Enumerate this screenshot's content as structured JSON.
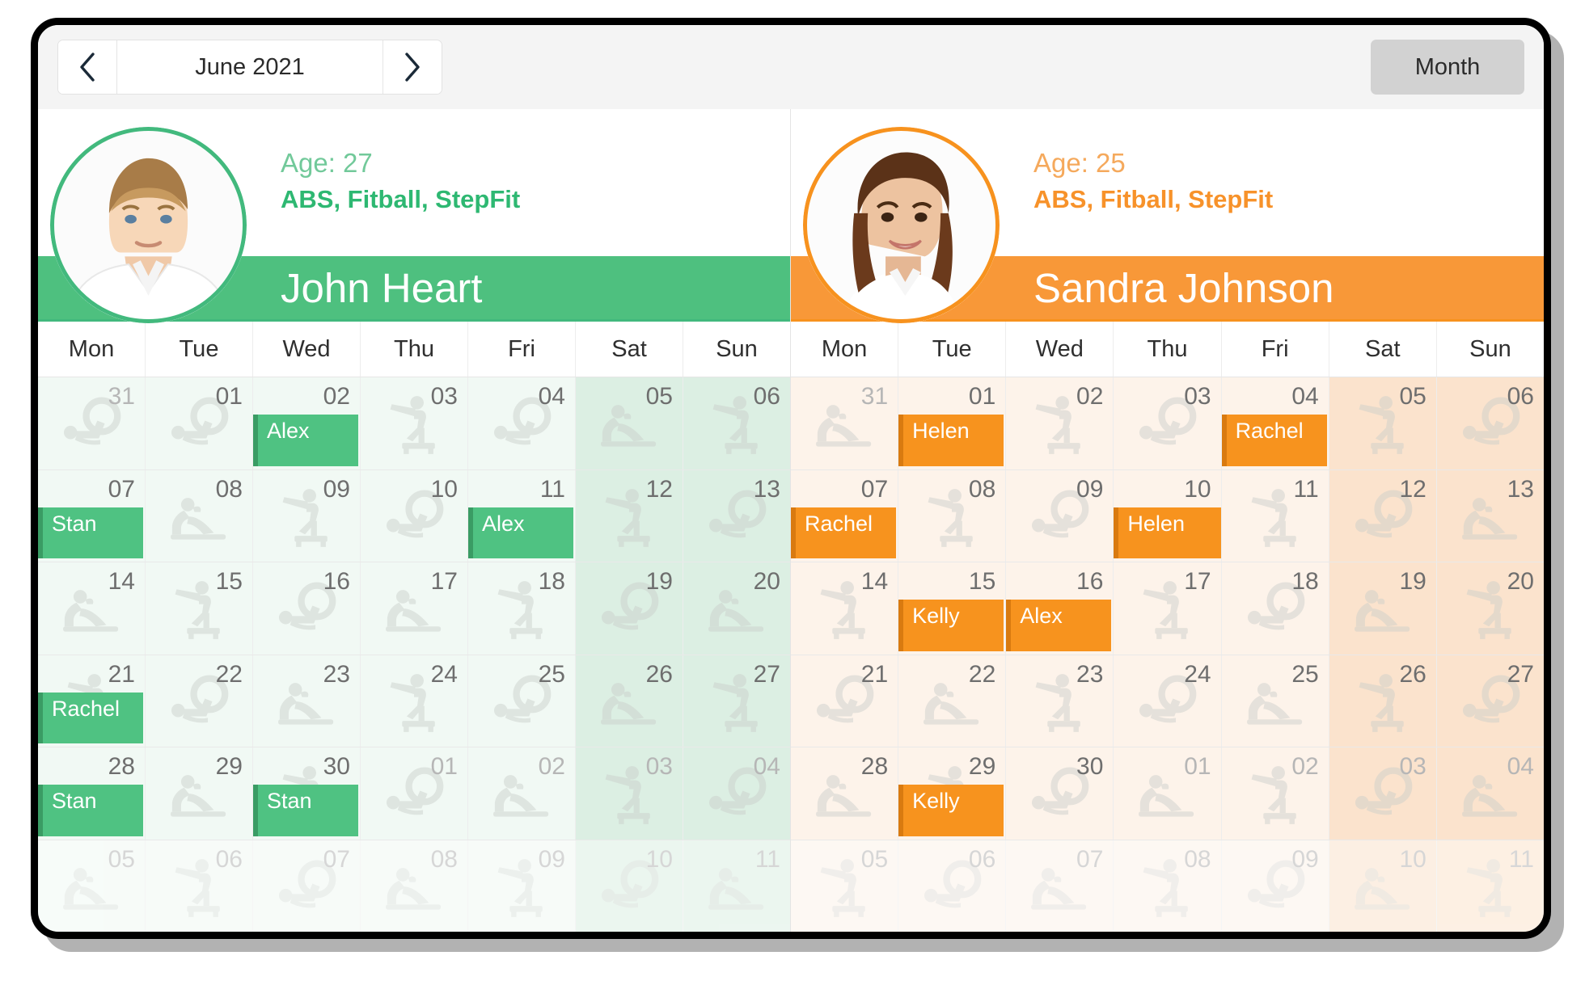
{
  "toolbar": {
    "prev_label": "chevron-left",
    "next_label": "chevron-right",
    "current_period": "June 2021",
    "view_label": "Month"
  },
  "weekdays": [
    "Mon",
    "Tue",
    "Wed",
    "Thu",
    "Fri",
    "Sat",
    "Sun"
  ],
  "panes": [
    {
      "id": "john",
      "theme": "green",
      "accent": "#4ec07f",
      "name": "John Heart",
      "age_label": "Age: 27",
      "classes": "ABS, Fitball, StepFit",
      "avatar": "male-portrait",
      "weeks": [
        {
          "days": [
            {
              "num": "31",
              "other": true,
              "weekend": false,
              "icon": "fitball"
            },
            {
              "num": "01",
              "other": false,
              "weekend": false,
              "icon": "fitball"
            },
            {
              "num": "02",
              "other": false,
              "weekend": false,
              "icon": "none",
              "appt": {
                "label": "Alex",
                "span": 1
              }
            },
            {
              "num": "03",
              "other": false,
              "weekend": false,
              "icon": "stepfit"
            },
            {
              "num": "04",
              "other": false,
              "weekend": false,
              "icon": "fitball"
            },
            {
              "num": "05",
              "other": false,
              "weekend": true,
              "icon": "abs"
            },
            {
              "num": "06",
              "other": false,
              "weekend": true,
              "icon": "stepfit"
            }
          ]
        },
        {
          "days": [
            {
              "num": "07",
              "other": false,
              "weekend": false,
              "icon": "none",
              "appt": {
                "label": "Stan",
                "span": 1
              }
            },
            {
              "num": "08",
              "other": false,
              "weekend": false,
              "icon": "abs"
            },
            {
              "num": "09",
              "other": false,
              "weekend": false,
              "icon": "stepfit"
            },
            {
              "num": "10",
              "other": false,
              "weekend": false,
              "icon": "fitball"
            },
            {
              "num": "11",
              "other": false,
              "weekend": false,
              "icon": "none",
              "appt": {
                "label": "Alex",
                "span": 1
              }
            },
            {
              "num": "12",
              "other": false,
              "weekend": true,
              "icon": "stepfit"
            },
            {
              "num": "13",
              "other": false,
              "weekend": true,
              "icon": "fitball"
            }
          ]
        },
        {
          "days": [
            {
              "num": "14",
              "other": false,
              "weekend": false,
              "icon": "abs"
            },
            {
              "num": "15",
              "other": false,
              "weekend": false,
              "icon": "stepfit"
            },
            {
              "num": "16",
              "other": false,
              "weekend": false,
              "icon": "fitball"
            },
            {
              "num": "17",
              "other": false,
              "weekend": false,
              "icon": "abs"
            },
            {
              "num": "18",
              "other": false,
              "weekend": false,
              "icon": "stepfit"
            },
            {
              "num": "19",
              "other": false,
              "weekend": true,
              "icon": "fitball"
            },
            {
              "num": "20",
              "other": false,
              "weekend": true,
              "icon": "abs"
            }
          ]
        },
        {
          "days": [
            {
              "num": "21",
              "other": false,
              "weekend": false,
              "icon": "stepfit",
              "appt": {
                "label": "Rachel",
                "span": 1
              }
            },
            {
              "num": "22",
              "other": false,
              "weekend": false,
              "icon": "fitball"
            },
            {
              "num": "23",
              "other": false,
              "weekend": false,
              "icon": "abs"
            },
            {
              "num": "24",
              "other": false,
              "weekend": false,
              "icon": "stepfit"
            },
            {
              "num": "25",
              "other": false,
              "weekend": false,
              "icon": "fitball"
            },
            {
              "num": "26",
              "other": false,
              "weekend": true,
              "icon": "abs"
            },
            {
              "num": "27",
              "other": false,
              "weekend": true,
              "icon": "stepfit"
            }
          ]
        },
        {
          "days": [
            {
              "num": "28",
              "other": false,
              "weekend": false,
              "icon": "none",
              "appt": {
                "label": "Stan",
                "span": 1
              }
            },
            {
              "num": "29",
              "other": false,
              "weekend": false,
              "icon": "abs"
            },
            {
              "num": "30",
              "other": false,
              "weekend": false,
              "icon": "stepfit",
              "appt": {
                "label": "Stan",
                "span": 1
              }
            },
            {
              "num": "01",
              "other": true,
              "weekend": false,
              "icon": "fitball"
            },
            {
              "num": "02",
              "other": true,
              "weekend": false,
              "icon": "abs"
            },
            {
              "num": "03",
              "other": true,
              "weekend": true,
              "icon": "stepfit"
            },
            {
              "num": "04",
              "other": true,
              "weekend": true,
              "icon": "fitball"
            }
          ]
        },
        {
          "faded": true,
          "days": [
            {
              "num": "05",
              "other": true,
              "weekend": false,
              "icon": "abs"
            },
            {
              "num": "06",
              "other": true,
              "weekend": false,
              "icon": "stepfit"
            },
            {
              "num": "07",
              "other": true,
              "weekend": false,
              "icon": "fitball"
            },
            {
              "num": "08",
              "other": true,
              "weekend": false,
              "icon": "abs"
            },
            {
              "num": "09",
              "other": true,
              "weekend": false,
              "icon": "stepfit"
            },
            {
              "num": "10",
              "other": true,
              "weekend": true,
              "icon": "fitball"
            },
            {
              "num": "11",
              "other": true,
              "weekend": true,
              "icon": "abs"
            }
          ]
        }
      ]
    },
    {
      "id": "sandra",
      "theme": "orange",
      "accent": "#f7931e",
      "name": "Sandra Johnson",
      "age_label": "Age: 25",
      "classes": "ABS, Fitball, StepFit",
      "avatar": "female-portrait",
      "weeks": [
        {
          "days": [
            {
              "num": "31",
              "other": true,
              "weekend": false,
              "icon": "abs"
            },
            {
              "num": "01",
              "other": false,
              "weekend": false,
              "icon": "none",
              "appt": {
                "label": "Helen",
                "span": 1
              }
            },
            {
              "num": "02",
              "other": false,
              "weekend": false,
              "icon": "stepfit"
            },
            {
              "num": "03",
              "other": false,
              "weekend": false,
              "icon": "fitball"
            },
            {
              "num": "04",
              "other": false,
              "weekend": false,
              "icon": "none",
              "appt": {
                "label": "Rachel",
                "span": 1
              }
            },
            {
              "num": "05",
              "other": false,
              "weekend": true,
              "icon": "stepfit"
            },
            {
              "num": "06",
              "other": false,
              "weekend": true,
              "icon": "fitball"
            }
          ]
        },
        {
          "days": [
            {
              "num": "07",
              "other": false,
              "weekend": false,
              "icon": "none",
              "appt": {
                "label": "Rachel",
                "span": 1
              }
            },
            {
              "num": "08",
              "other": false,
              "weekend": false,
              "icon": "stepfit"
            },
            {
              "num": "09",
              "other": false,
              "weekend": false,
              "icon": "fitball"
            },
            {
              "num": "10",
              "other": false,
              "weekend": false,
              "icon": "none",
              "appt": {
                "label": "Helen",
                "span": 2
              }
            },
            {
              "num": "11",
              "other": false,
              "weekend": false,
              "icon": "stepfit"
            },
            {
              "num": "12",
              "other": false,
              "weekend": true,
              "icon": "fitball"
            },
            {
              "num": "13",
              "other": false,
              "weekend": true,
              "icon": "abs"
            }
          ]
        },
        {
          "days": [
            {
              "num": "14",
              "other": false,
              "weekend": false,
              "icon": "stepfit"
            },
            {
              "num": "15",
              "other": false,
              "weekend": false,
              "icon": "none",
              "appt": {
                "label": "Kelly",
                "span": 1
              }
            },
            {
              "num": "16",
              "other": false,
              "weekend": false,
              "icon": "none",
              "appt": {
                "label": "Alex",
                "span": 1
              }
            },
            {
              "num": "17",
              "other": false,
              "weekend": false,
              "icon": "stepfit"
            },
            {
              "num": "18",
              "other": false,
              "weekend": false,
              "icon": "fitball"
            },
            {
              "num": "19",
              "other": false,
              "weekend": true,
              "icon": "abs"
            },
            {
              "num": "20",
              "other": false,
              "weekend": true,
              "icon": "stepfit"
            }
          ]
        },
        {
          "days": [
            {
              "num": "21",
              "other": false,
              "weekend": false,
              "icon": "fitball"
            },
            {
              "num": "22",
              "other": false,
              "weekend": false,
              "icon": "abs"
            },
            {
              "num": "23",
              "other": false,
              "weekend": false,
              "icon": "stepfit"
            },
            {
              "num": "24",
              "other": false,
              "weekend": false,
              "icon": "fitball"
            },
            {
              "num": "25",
              "other": false,
              "weekend": false,
              "icon": "abs"
            },
            {
              "num": "26",
              "other": false,
              "weekend": true,
              "icon": "stepfit"
            },
            {
              "num": "27",
              "other": false,
              "weekend": true,
              "icon": "fitball"
            }
          ]
        },
        {
          "days": [
            {
              "num": "28",
              "other": false,
              "weekend": false,
              "icon": "abs"
            },
            {
              "num": "29",
              "other": false,
              "weekend": false,
              "icon": "stepfit",
              "appt": {
                "label": "Kelly",
                "span": 1
              }
            },
            {
              "num": "30",
              "other": false,
              "weekend": false,
              "icon": "fitball"
            },
            {
              "num": "01",
              "other": true,
              "weekend": false,
              "icon": "abs"
            },
            {
              "num": "02",
              "other": true,
              "weekend": false,
              "icon": "stepfit"
            },
            {
              "num": "03",
              "other": true,
              "weekend": true,
              "icon": "fitball"
            },
            {
              "num": "04",
              "other": true,
              "weekend": true,
              "icon": "abs"
            }
          ]
        },
        {
          "faded": true,
          "days": [
            {
              "num": "05",
              "other": true,
              "weekend": false,
              "icon": "stepfit"
            },
            {
              "num": "06",
              "other": true,
              "weekend": false,
              "icon": "fitball"
            },
            {
              "num": "07",
              "other": true,
              "weekend": false,
              "icon": "abs"
            },
            {
              "num": "08",
              "other": true,
              "weekend": false,
              "icon": "stepfit"
            },
            {
              "num": "09",
              "other": true,
              "weekend": false,
              "icon": "fitball"
            },
            {
              "num": "10",
              "other": true,
              "weekend": true,
              "icon": "abs"
            },
            {
              "num": "11",
              "other": true,
              "weekend": true,
              "icon": "stepfit"
            }
          ]
        }
      ]
    }
  ]
}
